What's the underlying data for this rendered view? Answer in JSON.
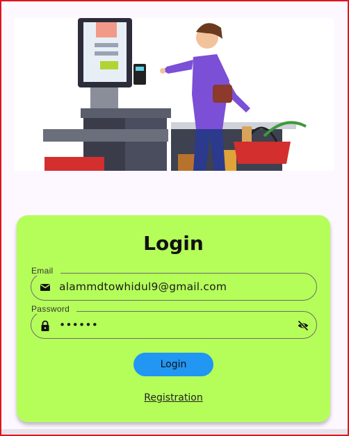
{
  "hero": {
    "illustration": "self-checkout-shopper-illustration"
  },
  "login": {
    "title": "Login",
    "email": {
      "label": "Email",
      "value": "alammdtowhidul9@gmail.com",
      "icon": "mail-icon"
    },
    "password": {
      "label": "Password",
      "value": "••••••",
      "icon": "lock-icon",
      "toggle_icon": "eye-off-icon"
    },
    "submit_label": "Login",
    "registration_label": "Registration"
  },
  "colors": {
    "background": "#fdf7ff",
    "card": "#b5fe5a",
    "button": "#2196f3",
    "frame": "#e0141e"
  }
}
